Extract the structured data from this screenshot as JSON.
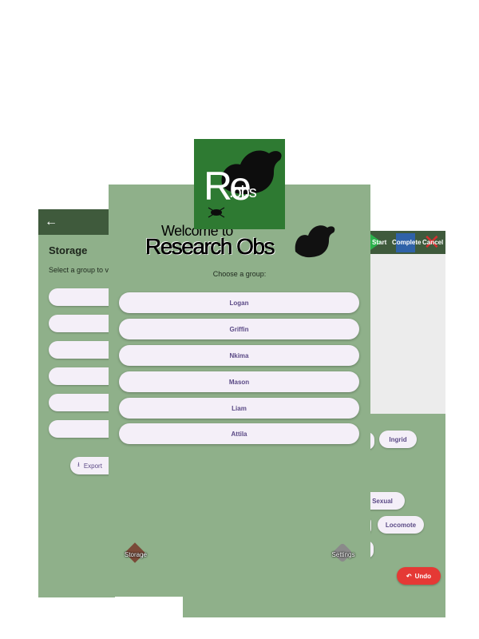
{
  "storage_screen": {
    "title": "Storage",
    "subtitle": "Select a group to v",
    "export_label": "Export"
  },
  "session_screen": {
    "start_label": "Start",
    "complete_label": "Complete",
    "cancel_label": "Cancel",
    "chips": [
      "Ingrid",
      "Sexual",
      "Locomote"
    ],
    "undo_label": "Undo"
  },
  "welcome_screen": {
    "welcome_text": "Welcome to",
    "app_name": "Research Obs",
    "prompt": "Choose a group:",
    "groups": [
      "Logan",
      "Griffin",
      "Nkima",
      "Mason",
      "Liam",
      "Attila"
    ],
    "nav": {
      "storage_label": "Storage",
      "settings_label": "Settings"
    }
  },
  "logo": {
    "text_main": "Re",
    "text_small": ".obs"
  },
  "colors": {
    "screen_bg": "#8fb08a",
    "appbar": "#3f5a3c",
    "button_bg": "#f4eff8",
    "button_text": "#5b4a86",
    "logo_bg": "#2e7a32",
    "undo": "#e53935"
  }
}
